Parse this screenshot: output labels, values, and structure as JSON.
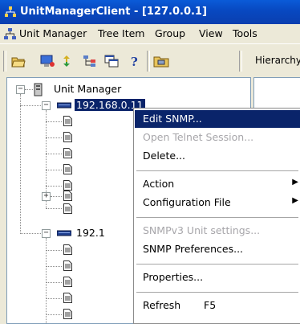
{
  "window": {
    "title": "UnitManagerClient - [127.0.0.1]"
  },
  "menubar": {
    "items": [
      {
        "label": "Unit Manager"
      },
      {
        "label": "Tree Item"
      },
      {
        "label": "Group"
      },
      {
        "label": "View"
      },
      {
        "label": "Tools"
      }
    ]
  },
  "toolbar": {
    "hierarchy_label": "Hierarchy"
  },
  "tree": {
    "root_label": "Unit Manager",
    "device1_label": "192.168.0.11",
    "device2_label": "192.1"
  },
  "context_menu": {
    "items": [
      {
        "label": "Edit SNMP...",
        "state": "highlighted"
      },
      {
        "label": "Open Telnet Session...",
        "state": "disabled"
      },
      {
        "label": "Delete...",
        "state": "enabled"
      },
      {
        "label": "Action",
        "state": "enabled",
        "submenu": true
      },
      {
        "label": "Configuration File",
        "state": "enabled",
        "submenu": true
      },
      {
        "label": "SNMPv3 Unit settings...",
        "state": "disabled"
      },
      {
        "label": "SNMP Preferences...",
        "state": "enabled"
      },
      {
        "label": "Properties...",
        "state": "enabled"
      },
      {
        "label": "Refresh",
        "shortcut": "F5",
        "state": "enabled"
      }
    ]
  },
  "colors": {
    "titlebar": "#0848c0",
    "selection": "#0a246a",
    "disabled_text": "#a7a6aa"
  }
}
